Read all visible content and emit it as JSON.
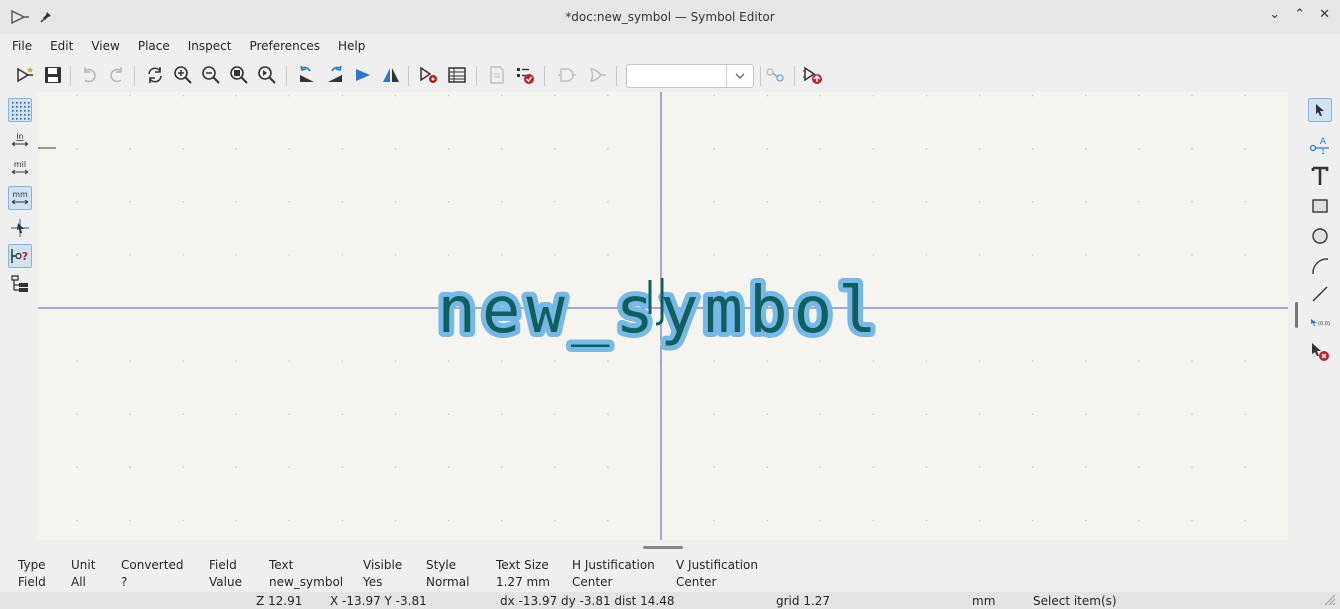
{
  "window": {
    "title": "*doc:new_symbol — Symbol Editor"
  },
  "menubar": {
    "items": [
      "File",
      "Edit",
      "View",
      "Place",
      "Inspect",
      "Preferences",
      "Help"
    ]
  },
  "toolbar": {
    "unit_combo_value": "",
    "icons": [
      "new-symbol-icon",
      "save-icon",
      "undo-icon",
      "redo-icon",
      "refresh-icon",
      "zoom-in-icon",
      "zoom-out-icon",
      "zoom-fit-icon",
      "zoom-objects-icon",
      "rotate-ccw-icon",
      "rotate-cw-icon",
      "mirror-h-icon",
      "mirror-v-icon",
      "symbol-properties-icon",
      "pin-table-icon",
      "datasheet-icon",
      "symbol-checker-icon",
      "de-morgan-standard-icon",
      "de-morgan-alternate-icon",
      "sync-pins-icon",
      "add-to-schematic-icon"
    ]
  },
  "left_toolbar": {
    "unit_in": "in",
    "unit_mil": "mil",
    "unit_mm": "mm",
    "selected_unit": "mm"
  },
  "canvas": {
    "symbol_text": "new_symbol",
    "colors": {
      "background": "#f5f4ef",
      "axis": "#5a56b8",
      "text": "#0f5f61",
      "text_highlight": "#78b8e6"
    }
  },
  "message_panel": {
    "columns": [
      {
        "header": "Type",
        "value": "Field"
      },
      {
        "header": "Unit",
        "value": "All"
      },
      {
        "header": "Converted",
        "value": "?"
      },
      {
        "header": "Field",
        "value": "Value"
      },
      {
        "header": "Text",
        "value": "new_symbol"
      },
      {
        "header": "Visible",
        "value": "Yes"
      },
      {
        "header": "Style",
        "value": "Normal"
      },
      {
        "header": "Text Size",
        "value": "1.27 mm"
      },
      {
        "header": "H Justification",
        "value": "Center"
      },
      {
        "header": "V Justification",
        "value": "Center"
      }
    ]
  },
  "statusbar": {
    "zoom": "Z 12.91",
    "cursor": "X -13.97  Y -3.81",
    "delta": "dx -13.97  dy -3.81  dist 14.48",
    "grid": "grid 1.27",
    "units": "mm",
    "mode": "Select item(s)"
  }
}
